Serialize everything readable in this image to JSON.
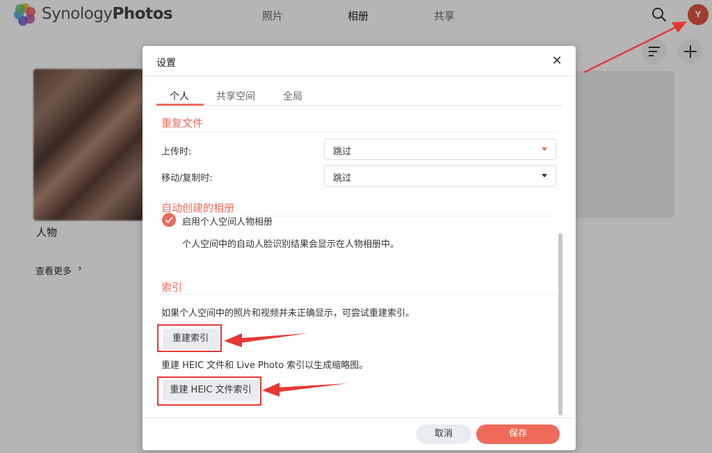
{
  "app": {
    "brand_light": "Synology",
    "brand_bold": "Photos",
    "nav": [
      {
        "label": "照片",
        "active": false
      },
      {
        "label": "相册",
        "active": true
      },
      {
        "label": "共享",
        "active": false
      }
    ],
    "avatar_letter": "Y",
    "people_label": "人物",
    "see_more": "查看更多",
    "see_more_chevron": "›"
  },
  "dialog": {
    "title": "设置",
    "close": "✕",
    "tabs": [
      {
        "label": "个人",
        "active": true
      },
      {
        "label": "共享空间",
        "active": false
      },
      {
        "label": "全局",
        "active": false
      }
    ],
    "duplicates": {
      "title": "重复文件",
      "upload_label": "上传时:",
      "upload_value": "跳过",
      "move_copy_label": "移动/复制时:",
      "move_copy_value": "跳过"
    },
    "auto_albums": {
      "title": "自动创建的相册",
      "checkbox_label": "启用个人空间人物相册",
      "checked": true,
      "description": "个人空间中的自动人脸识别结果会显示在人物相册中。"
    },
    "index": {
      "title": "索引",
      "description": "如果个人空间中的照片和视频并未正确显示，可尝试重建索引。",
      "rebuild_button": "重建索引",
      "heic_description": "重建 HEIC 文件和 Live Photo 索引以生成缩略图。",
      "rebuild_heic_button": "重建 HEIC 文件索引"
    },
    "cancel": "取消",
    "save": "保存"
  },
  "colors": {
    "accent": "#ef6a5a",
    "annotation_red": "#e53935",
    "avatar": "#e0553f"
  }
}
